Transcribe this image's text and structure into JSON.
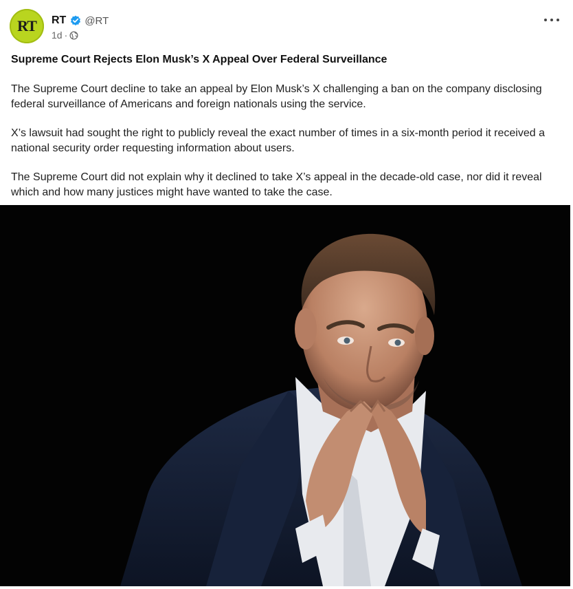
{
  "post": {
    "author": {
      "name": "RT",
      "handle": "@RT",
      "avatar_text": "RT",
      "verified": true,
      "avatar_color": "#b9d51f",
      "verified_color": "#1d9bf0"
    },
    "meta": {
      "time": "1d",
      "separator": "·",
      "visibility_icon": "globe-icon"
    },
    "more_icon": "ellipsis-icon",
    "headline": "Supreme Court Rejects Elon Musk’s X Appeal Over Federal Surveillance",
    "paragraphs": [
      "The Supreme Court decline to take an appeal by Elon Musk’s X challenging a ban on the company disclosing federal surveillance of Americans and foreign nationals using the service.",
      "X’s lawsuit had sought the right to publicly reveal the exact number of times in a six-month period it received a national security order requesting information about users.",
      "The Supreme Court did not explain why it declined to take X’s appeal in the decade-old case, nor did it reveal which and how many justices might have wanted to take the case."
    ],
    "image": {
      "subject": "man in dark suit with hands steepled against black background"
    }
  }
}
